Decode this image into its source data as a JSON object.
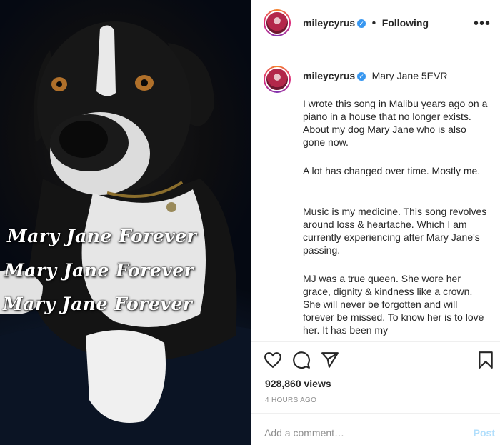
{
  "photo": {
    "caption_lines": [
      "Mary Jane Forever",
      "Mary Jane Forever",
      "Mary Jane Forever"
    ]
  },
  "header": {
    "username": "mileycyrus",
    "separator": "•",
    "follow_status": "Following",
    "more_icon": "more-horizontal-icon"
  },
  "caption": {
    "username": "mileycyrus",
    "title": "Mary Jane 5EVR",
    "paragraphs": [
      "I wrote this song in Malibu years ago on a piano in a house that no longer exists. About my dog Mary Jane who is also gone now.",
      "A lot has changed over time. Mostly me.",
      "Music is my medicine. This song revolves around loss & heartache. Which I am currently experiencing after Mary Jane's passing.",
      "MJ was a true queen. She wore her grace, dignity & kindness like a crown. She will never be forgotten and will forever be missed. To know her is to love her. It has been my"
    ]
  },
  "actions": {
    "icons": [
      "heart-icon",
      "comment-icon",
      "share-icon",
      "bookmark-icon"
    ],
    "views": "928,860 views",
    "time": "4 HOURS AGO"
  },
  "comment": {
    "placeholder": "Add a comment…",
    "post_label": "Post"
  },
  "colors": {
    "verified": "#3897f0",
    "post_disabled": "#b2dffc",
    "secondary_text": "#8e8e8e"
  }
}
